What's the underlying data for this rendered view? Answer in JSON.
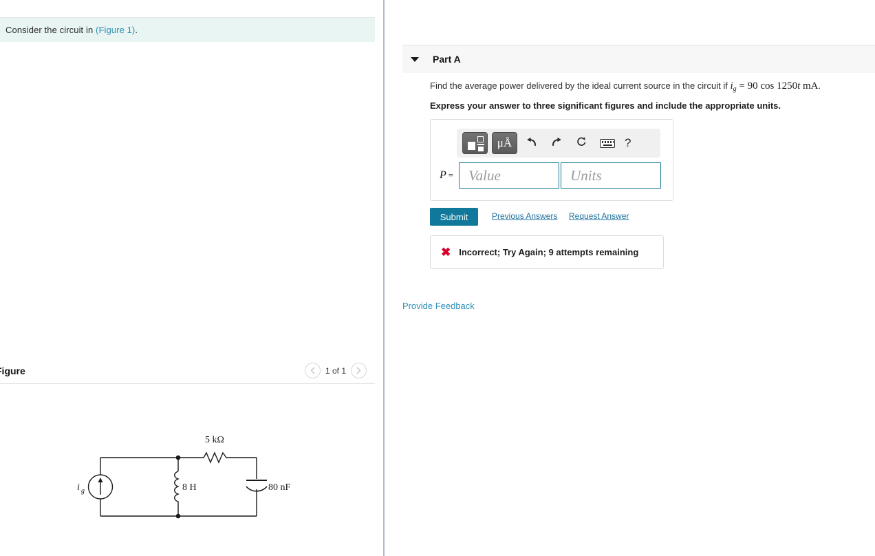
{
  "left": {
    "intro": {
      "text_before": "Consider the circuit in ",
      "link": "(Figure 1)",
      "text_after": "."
    },
    "figure": {
      "title": "Figure",
      "pager_label": "1 of 1",
      "prev_icon": "chevron-left-icon",
      "next_icon": "chevron-right-icon"
    },
    "circuit": {
      "source_label": "ig",
      "inductor_label": "8 H",
      "resistor_label": "5 kΩ",
      "capacitor_label": "80 nF"
    }
  },
  "right": {
    "part": {
      "title": "Part A",
      "collapse_icon": "caret-down-icon"
    },
    "question": {
      "prefix": "Find the average power delivered by the ideal current source in the circuit if ",
      "math_var": "i",
      "math_sub": "g",
      "math_eq": " = 90 cos 1250",
      "math_t": "t",
      "math_unit": " mA",
      "suffix": ".",
      "instruction": "Express your answer to three significant figures and include the appropriate units."
    },
    "toolbar": {
      "template_icon": "math-template-icon",
      "units_icon": "micro-angstrom-units-icon",
      "units_label": "μÅ",
      "undo_icon": "undo-icon",
      "undo_glyph": "↰",
      "redo_icon": "redo-icon",
      "redo_glyph": "↱",
      "reset_icon": "reset-icon",
      "reset_glyph": "↻",
      "keyboard_icon": "keyboard-icon",
      "help_icon": "help-icon",
      "help_glyph": "?"
    },
    "answer": {
      "variable": "P",
      "equals": "=",
      "value_placeholder": "Value",
      "units_placeholder": "Units",
      "value": "",
      "units": ""
    },
    "actions": {
      "submit_label": "Submit",
      "previous_answers_label": "Previous Answers",
      "request_answer_label": "Request Answer"
    },
    "feedback": {
      "status_icon": "x-mark-icon",
      "status_glyph": "✖",
      "message": "Incorrect; Try Again; 9 attempts remaining"
    },
    "provide_feedback_label": "Provide Feedback"
  },
  "colors": {
    "banner_bg": "#e8f5f3",
    "link": "#2f8fb5",
    "submit": "#10789a",
    "field_border": "#1b7b94",
    "error": "#d9002b",
    "divider": "#aebcd0"
  }
}
